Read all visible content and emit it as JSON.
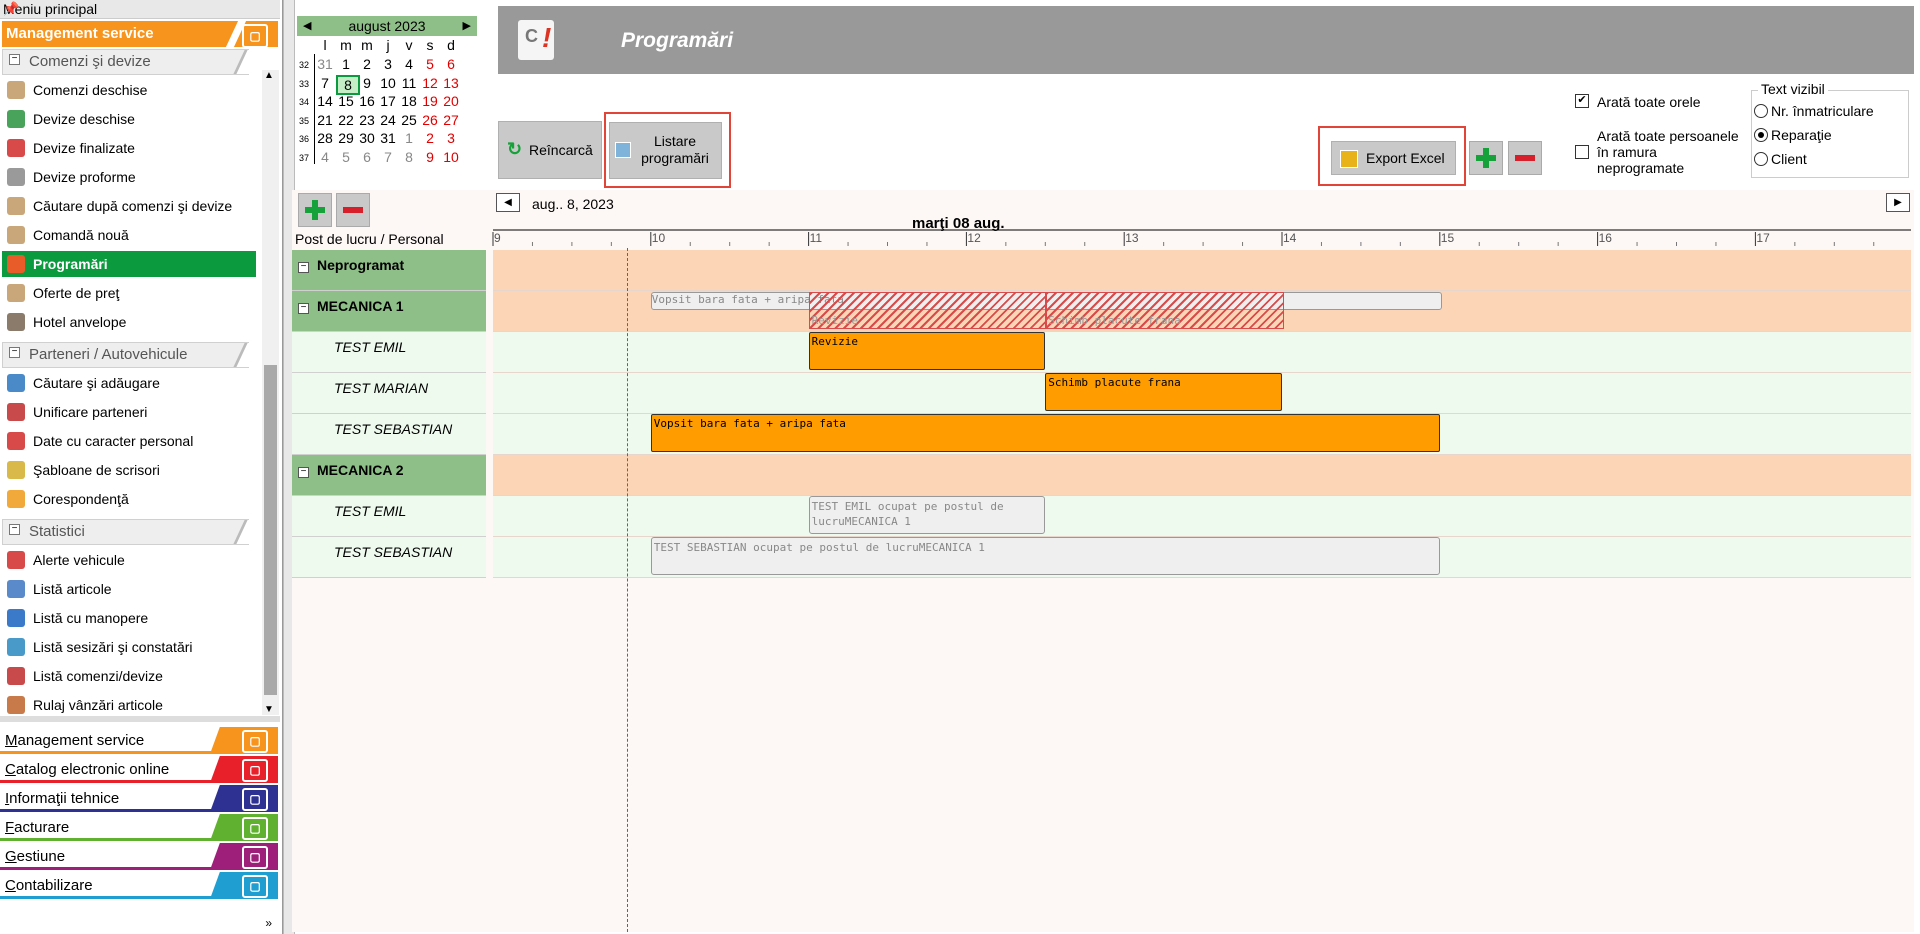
{
  "menu": {
    "header": "Meniu principal",
    "module_title": "Management service",
    "sections": [
      {
        "title": "Comenzi şi devize",
        "items": [
          "Comenzi deschise",
          "Devize deschise",
          "Devize finalizate",
          "Devize proforme",
          "Căutare după comenzi şi devize",
          "Comandă nouă",
          "Programări",
          "Oferte de preţ",
          "Hotel anvelope"
        ]
      },
      {
        "title": "Parteneri / Autovehicule",
        "items": [
          "Căutare şi adăugare",
          "Unificare parteneri",
          "Date cu caracter personal",
          "Şabloane de scrisori",
          "Corespondenţă"
        ]
      },
      {
        "title": "Statistici",
        "items": [
          "Alerte vehicule",
          "Listă articole",
          "Listă cu manopere",
          "Listă sesizări şi constatări",
          "Listă comenzi/devize",
          "Rulaj vânzări articole"
        ]
      }
    ],
    "active_item": "Programări",
    "bottom_modules": [
      {
        "label": "Management service",
        "color": "#f7941d"
      },
      {
        "label": "Catalog electronic online",
        "color": "#e8202a"
      },
      {
        "label": "Informaţii tehnice",
        "color": "#2e3192"
      },
      {
        "label": "Facturare",
        "color": "#5fb12f"
      },
      {
        "label": "Gestiune",
        "color": "#9e1f7a"
      },
      {
        "label": "Contabilizare",
        "color": "#1f9ed1"
      }
    ]
  },
  "calendar": {
    "title": "august 2023",
    "weekdays": [
      "l",
      "m",
      "m",
      "j",
      "v",
      "s",
      "d"
    ],
    "weeks": [
      {
        "wk": "32",
        "days": [
          "31",
          "1",
          "2",
          "3",
          "4",
          "5",
          "6"
        ]
      },
      {
        "wk": "33",
        "days": [
          "7",
          "8",
          "9",
          "10",
          "11",
          "12",
          "13"
        ]
      },
      {
        "wk": "34",
        "days": [
          "14",
          "15",
          "16",
          "17",
          "18",
          "19",
          "20"
        ]
      },
      {
        "wk": "35",
        "days": [
          "21",
          "22",
          "23",
          "24",
          "25",
          "26",
          "27"
        ]
      },
      {
        "wk": "36",
        "days": [
          "28",
          "29",
          "30",
          "31",
          "1",
          "2",
          "3"
        ]
      },
      {
        "wk": "37",
        "days": [
          "4",
          "5",
          "6",
          "7",
          "8",
          "9",
          "10"
        ]
      }
    ],
    "selected_day": "8"
  },
  "banner": {
    "title": "Programări"
  },
  "toolbar": {
    "reload": "Reîncarcă",
    "list_line1": "Listare",
    "list_line2": "programări",
    "export": "Export Excel"
  },
  "options": {
    "show_all_hours": "Arată toate orele",
    "show_all_staff_l1": "Arată toate persoanele",
    "show_all_staff_l2": "în ramura",
    "show_all_staff_l3": "neprogramate",
    "visible_text_title": "Text vizibil",
    "radio_options": [
      "Nr. înmatriculare",
      "Reparaţie",
      "Client"
    ],
    "selected_radio": "Reparaţie"
  },
  "schedule": {
    "date_nav": "aug.. 8, 2023",
    "day_header": "marţi 08 aug.",
    "column_header": "Post de lucru / Personal",
    "hours": [
      "9",
      "10",
      "11",
      "12",
      "13",
      "14",
      "15",
      "16",
      "17"
    ],
    "rows": [
      {
        "label": "Neprogramat",
        "type": "group"
      },
      {
        "label": "MECANICA 1",
        "type": "group"
      },
      {
        "label": "TEST EMIL",
        "type": "person"
      },
      {
        "label": "TEST MARIAN",
        "type": "person"
      },
      {
        "label": "TEST SEBASTIAN",
        "type": "person"
      },
      {
        "label": "MECANICA 2",
        "type": "group"
      },
      {
        "label": "TEST EMIL",
        "type": "person"
      },
      {
        "label": "TEST SEBASTIAN",
        "type": "person"
      }
    ],
    "appointments": [
      {
        "row": 1,
        "text": "Vopsit bara fata + aripa fata",
        "start": 10.0,
        "end": 15.0,
        "style": "summary"
      },
      {
        "row": 1,
        "text": "Revizie",
        "start": 11.0,
        "end": 12.5,
        "style": "summary-sub"
      },
      {
        "row": 1,
        "text": "Schimb placute frana",
        "start": 12.5,
        "end": 14.0,
        "style": "summary-sub"
      },
      {
        "row": 2,
        "text": "Revizie",
        "start": 11.0,
        "end": 12.5,
        "style": "orange"
      },
      {
        "row": 3,
        "text": "Schimb placute frana",
        "start": 12.5,
        "end": 14.0,
        "style": "orange"
      },
      {
        "row": 4,
        "text": "Vopsit bara fata + aripa fata",
        "start": 10.0,
        "end": 15.0,
        "style": "orange"
      },
      {
        "row": 6,
        "text": "TEST EMIL ocupat pe postul de lucruMECANICA 1",
        "start": 11.0,
        "end": 12.5,
        "style": "ghost"
      },
      {
        "row": 7,
        "text": "TEST SEBASTIAN ocupat pe postul de lucruMECANICA 1",
        "start": 10.0,
        "end": 15.0,
        "style": "ghost"
      }
    ],
    "current_time": 9.85
  }
}
